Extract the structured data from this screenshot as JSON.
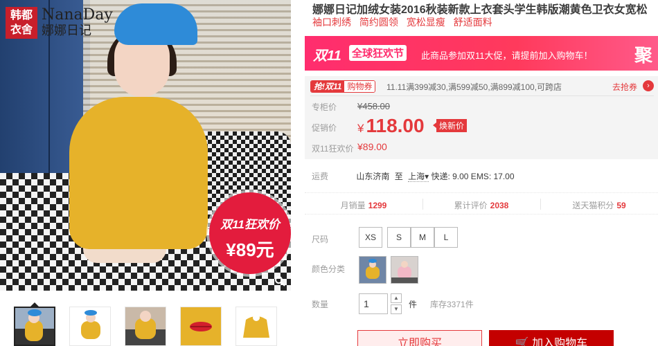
{
  "brand": {
    "logo_text": "韩都\n衣舍",
    "name_en": "NanaDay",
    "name_cn": "娜娜日记"
  },
  "product": {
    "title": "娜娜日记加绒女装2016秋装新款上衣套头学生韩版潮黄色卫衣女宽松",
    "features": [
      "袖口刺绣",
      "简约圆领",
      "宽松显瘦",
      "舒适面料"
    ]
  },
  "promo_overlay": {
    "line1": "双11狂欢价",
    "line2": "¥89元"
  },
  "banner": {
    "logo": "双11",
    "tag": "全球狂欢节",
    "text": "此商品参加双11大促，请提前加入购物车！",
    "ju": "聚"
  },
  "coupon": {
    "badge_a": "抢!双11",
    "badge_b": "购物券",
    "text": "11.11满399减30,满599减50,满899减100,可跨店",
    "link": "去抢券",
    "arrow": "›"
  },
  "prices": {
    "original_label": "专柜价",
    "original_value": "¥458.00",
    "promo_label": "促销价",
    "currency": "¥",
    "promo_value": "118.00",
    "new_tag": "焕新价",
    "double11_label": "双11狂欢价",
    "double11_value": "¥89.00"
  },
  "shipping": {
    "label": "运费",
    "from": "山东济南",
    "to_word": "至",
    "to": "上海",
    "dropdown_icon": "▾",
    "fees": "快递: 9.00 EMS: 17.00"
  },
  "stats": [
    {
      "label": "月销量",
      "value": "1299"
    },
    {
      "label": "累计评价",
      "value": "2038"
    },
    {
      "label": "送天猫积分",
      "value": "59"
    }
  ],
  "size": {
    "label": "尺码",
    "options": [
      "XS",
      "S",
      "M",
      "L"
    ]
  },
  "color": {
    "label": "颜色分类"
  },
  "quantity": {
    "label": "数量",
    "value": "1",
    "unit": "件",
    "stock": "库存3371件"
  },
  "actions": {
    "buy_now": "立即购买",
    "add_cart": "加入购物车"
  }
}
